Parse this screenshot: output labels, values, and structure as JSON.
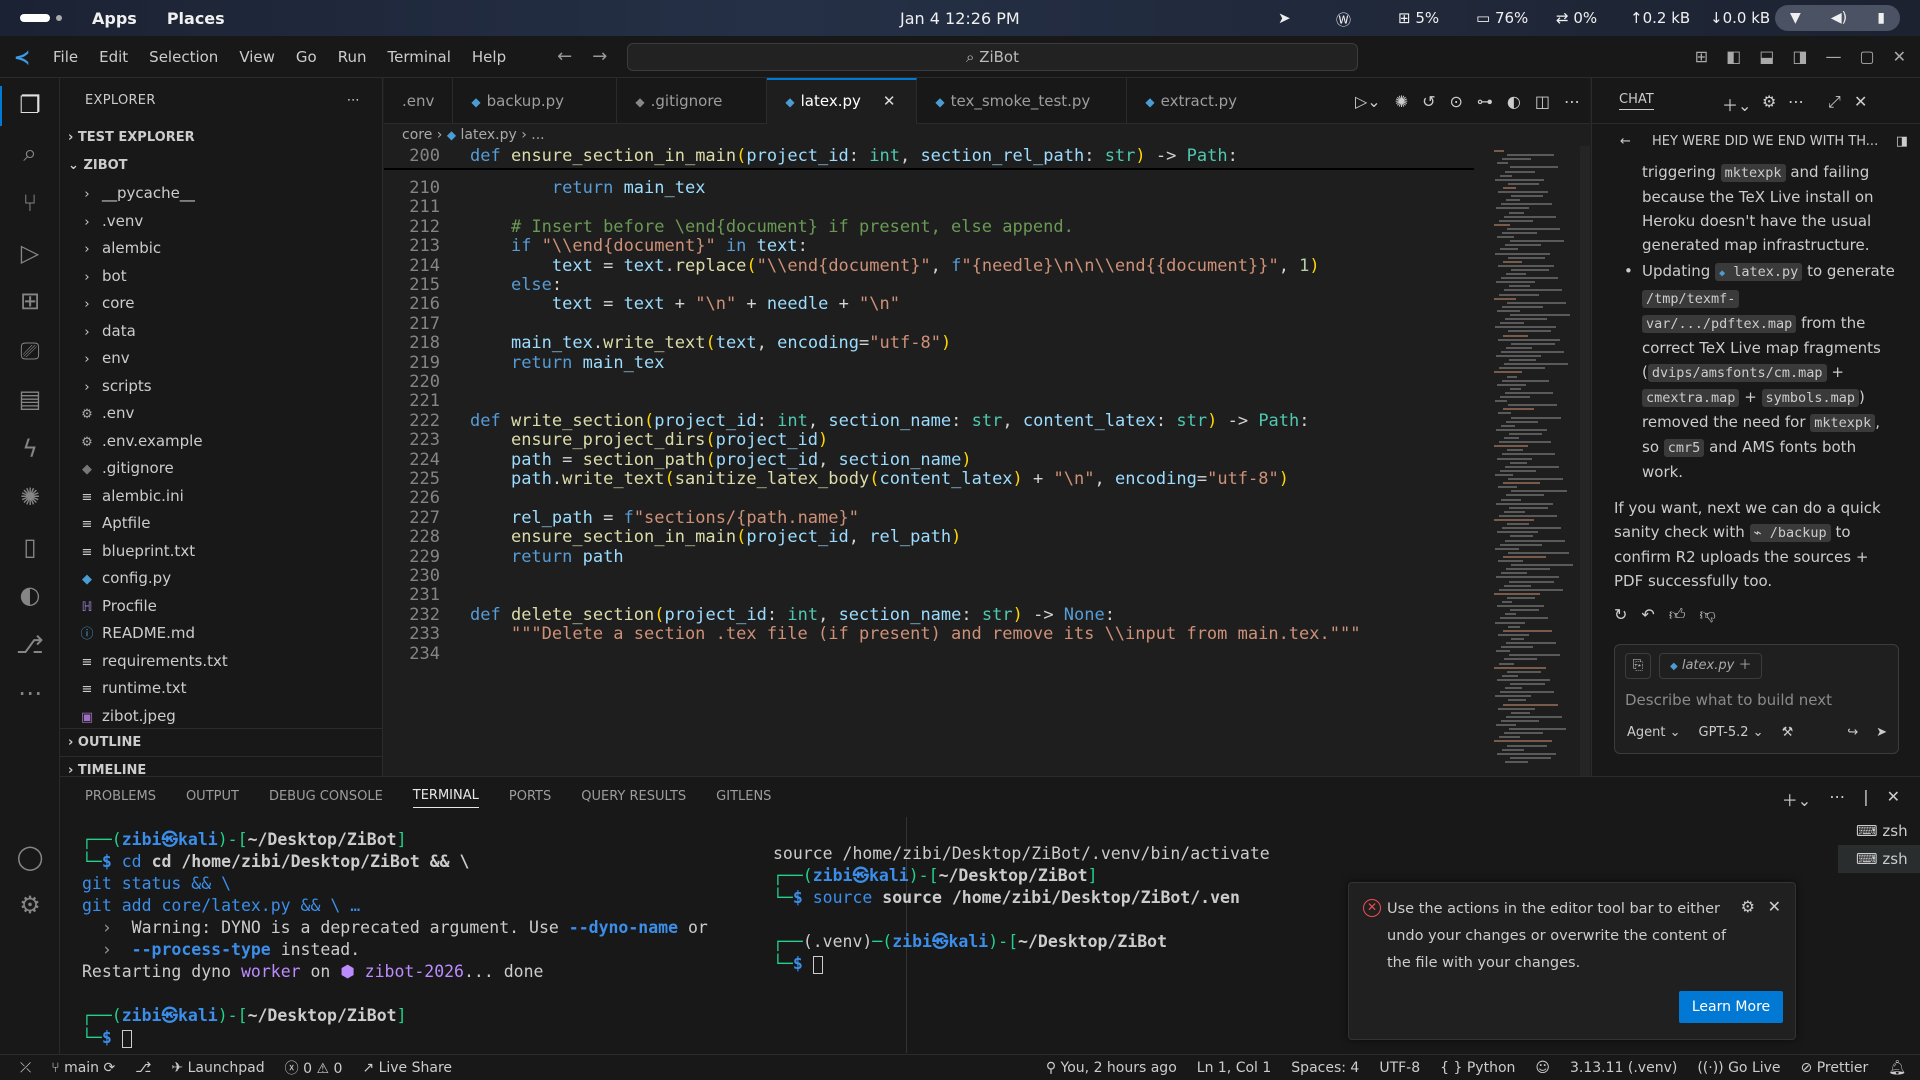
{
  "os": {
    "apps": "Apps",
    "places": "Places",
    "clock": "Jan 4  12:26 PM",
    "cpu": "5%",
    "mem": "76%",
    "swap": "0%",
    "up": "0.2 kB",
    "down": "0.0 kB"
  },
  "menu": {
    "items": [
      "File",
      "Edit",
      "Selection",
      "View",
      "Go",
      "Run",
      "Terminal",
      "Help"
    ],
    "search": "ZiBot"
  },
  "explorer": {
    "title": "EXPLORER",
    "sections": {
      "test": "TEST EXPLORER",
      "project": "ZIBOT",
      "outline": "OUTLINE",
      "timeline": "TIMELINE"
    },
    "items": [
      {
        "label": "__pycache__",
        "icon": "chevron-right"
      },
      {
        "label": ".venv",
        "icon": "chevron-right"
      },
      {
        "label": "alembic",
        "icon": "chevron-right"
      },
      {
        "label": "bot",
        "icon": "chevron-right"
      },
      {
        "label": "core",
        "icon": "chevron-right"
      },
      {
        "label": "data",
        "icon": "chevron-right"
      },
      {
        "label": "env",
        "icon": "chevron-right"
      },
      {
        "label": "scripts",
        "icon": "chevron-right"
      },
      {
        "label": ".env",
        "icon": "gear"
      },
      {
        "label": ".env.example",
        "icon": "gear"
      },
      {
        "label": ".gitignore",
        "icon": "git"
      },
      {
        "label": "alembic.ini",
        "icon": "lines"
      },
      {
        "label": "Aptfile",
        "icon": "lines"
      },
      {
        "label": "blueprint.txt",
        "icon": "lines"
      },
      {
        "label": "config.py",
        "icon": "python"
      },
      {
        "label": "Procfile",
        "icon": "heroku"
      },
      {
        "label": "README.md",
        "icon": "info"
      },
      {
        "label": "requirements.txt",
        "icon": "lines"
      },
      {
        "label": "runtime.txt",
        "icon": "lines"
      },
      {
        "label": "zibot.jpeg",
        "icon": "image"
      }
    ]
  },
  "tabs": [
    {
      "label": ".env"
    },
    {
      "label": "backup.py"
    },
    {
      "label": ".gitignore"
    },
    {
      "label": "latex.py"
    },
    {
      "label": "tex_smoke_test.py"
    },
    {
      "label": "extract.py"
    }
  ],
  "breadcrumb": {
    "a": "core",
    "b": "latex.py",
    "c": "..."
  },
  "code": {
    "sticky_no": "200",
    "sticky": "def ensure_section_in_main(project_id: int, section_rel_path: str) -> Path:",
    "lines": [
      {
        "n": "210",
        "t": "        return main_tex"
      },
      {
        "n": "211",
        "t": ""
      },
      {
        "n": "212",
        "t": "    # Insert before \\end{document} if present, else append."
      },
      {
        "n": "213",
        "t": "    if \"\\\\end{document}\" in text:"
      },
      {
        "n": "214",
        "t": "        text = text.replace(\"\\\\end{document}\", f\"{needle}\\n\\n\\\\end{{document}}\", 1)"
      },
      {
        "n": "215",
        "t": "    else:"
      },
      {
        "n": "216",
        "t": "        text = text + \"\\n\" + needle + \"\\n\""
      },
      {
        "n": "217",
        "t": ""
      },
      {
        "n": "218",
        "t": "    main_tex.write_text(text, encoding=\"utf-8\")"
      },
      {
        "n": "219",
        "t": "    return main_tex"
      },
      {
        "n": "220",
        "t": ""
      },
      {
        "n": "221",
        "t": ""
      },
      {
        "n": "222",
        "t": "def write_section(project_id: int, section_name: str, content_latex: str) -> Path:"
      },
      {
        "n": "223",
        "t": "    ensure_project_dirs(project_id)"
      },
      {
        "n": "224",
        "t": "    path = section_path(project_id, section_name)"
      },
      {
        "n": "225",
        "t": "    path.write_text(sanitize_latex_body(content_latex) + \"\\n\", encoding=\"utf-8\")"
      },
      {
        "n": "226",
        "t": ""
      },
      {
        "n": "227",
        "t": "    rel_path = f\"sections/{path.name}\""
      },
      {
        "n": "228",
        "t": "    ensure_section_in_main(project_id, rel_path)"
      },
      {
        "n": "229",
        "t": "    return path"
      },
      {
        "n": "230",
        "t": ""
      },
      {
        "n": "231",
        "t": ""
      },
      {
        "n": "232",
        "t": "def delete_section(project_id: int, section_name: str) -> None:"
      },
      {
        "n": "233",
        "t": "    \"\"\"Delete a section .tex file (if present) and remove its \\\\input from main.tex.\"\"\""
      },
      {
        "n": "234",
        "t": ""
      }
    ]
  },
  "chat": {
    "title": "CHAT",
    "thread": "HEY WERE DID WE END WITH TH...",
    "p1": "triggering",
    "p1b": "mktexpk",
    "p1c": "and failing because the TeX Live install on Heroku doesn't have the usual generated map infrastructure.",
    "b1": "Updating",
    "b1f": "latex.py",
    "b1c": "to generate",
    "b1d": "/tmp/texmf-",
    "b1e": "var/.../pdftex.map",
    "b1g": "from the correct TeX Live map fragments (",
    "b1h": "dvips/amsfonts/cm.map",
    "b1i": "+",
    "b1j": "cmextra.map",
    "b1k": "+",
    "b1l": "symbols.map",
    ")": ")",
    "b1m": "removed the need for",
    "b1n": "mktexpk",
    ",": ", so",
    "b1o": "cmr5",
    "b1p": "and AMS fonts both work.",
    "p2": "If you want, next we can do a quick sanity check with",
    "p2b": "/backup",
    "p2c": "to confirm R2 uploads the sources + PDF successfully too.",
    "file": "latex.py",
    "placeholder": "Describe what to build next",
    "mode": "Agent",
    "model": "GPT-5.2"
  },
  "panel": {
    "tabs": [
      "PROBLEMS",
      "OUTPUT",
      "DEBUG CONSOLE",
      "TERMINAL",
      "PORTS",
      "QUERY RESULTS",
      "GITLENS"
    ],
    "terms": [
      "zsh",
      "zsh"
    ]
  },
  "term1": {
    "user": "zibi",
    "host": "kali",
    "path": "~/Desktop/ZiBot",
    "cmd1": "cd /home/zibi/Desktop/ZiBot && \\",
    "cmd2": "git status && \\",
    "cmd3": "git add core/latex.py && \\ …",
    "w1": "Warning: DYNO is a deprecated argument. Use",
    "w1b": "--dyno-name",
    "w1c": "or",
    "w2": "--process-type",
    "w2b": "instead.",
    "r1": "Restarting dyno",
    "r1b": "worker",
    "r1c": "on",
    "r1d": "zibot-2026",
    "r1e": "... done"
  },
  "term2": {
    "l1": "source /home/zibi/Desktop/ZiBot/.venv/bin/activate",
    "user": "zibi",
    "host": "kali",
    "path": "~/Desktop/ZiBot",
    "cmd": "source /home/zibi/Desktop/ZiBot/.ven",
    "venv": "(.venv)"
  },
  "toast": {
    "message": "Use the actions in the editor tool bar to either undo your changes or overwrite the content of the file with your changes.",
    "button": "Learn More"
  },
  "status": {
    "branch": "main",
    "launchpad": "Launchpad",
    "errors": "0",
    "warnings": "0",
    "liveshare": "Live Share",
    "blame": "You, 2 hours ago",
    "position": "Ln 1, Col 1",
    "spaces": "Spaces: 4",
    "encoding": "UTF-8",
    "lang": "Python",
    "interp": "3.13.11 (.venv)",
    "golive": "Go Live",
    "prettier": "Prettier"
  }
}
